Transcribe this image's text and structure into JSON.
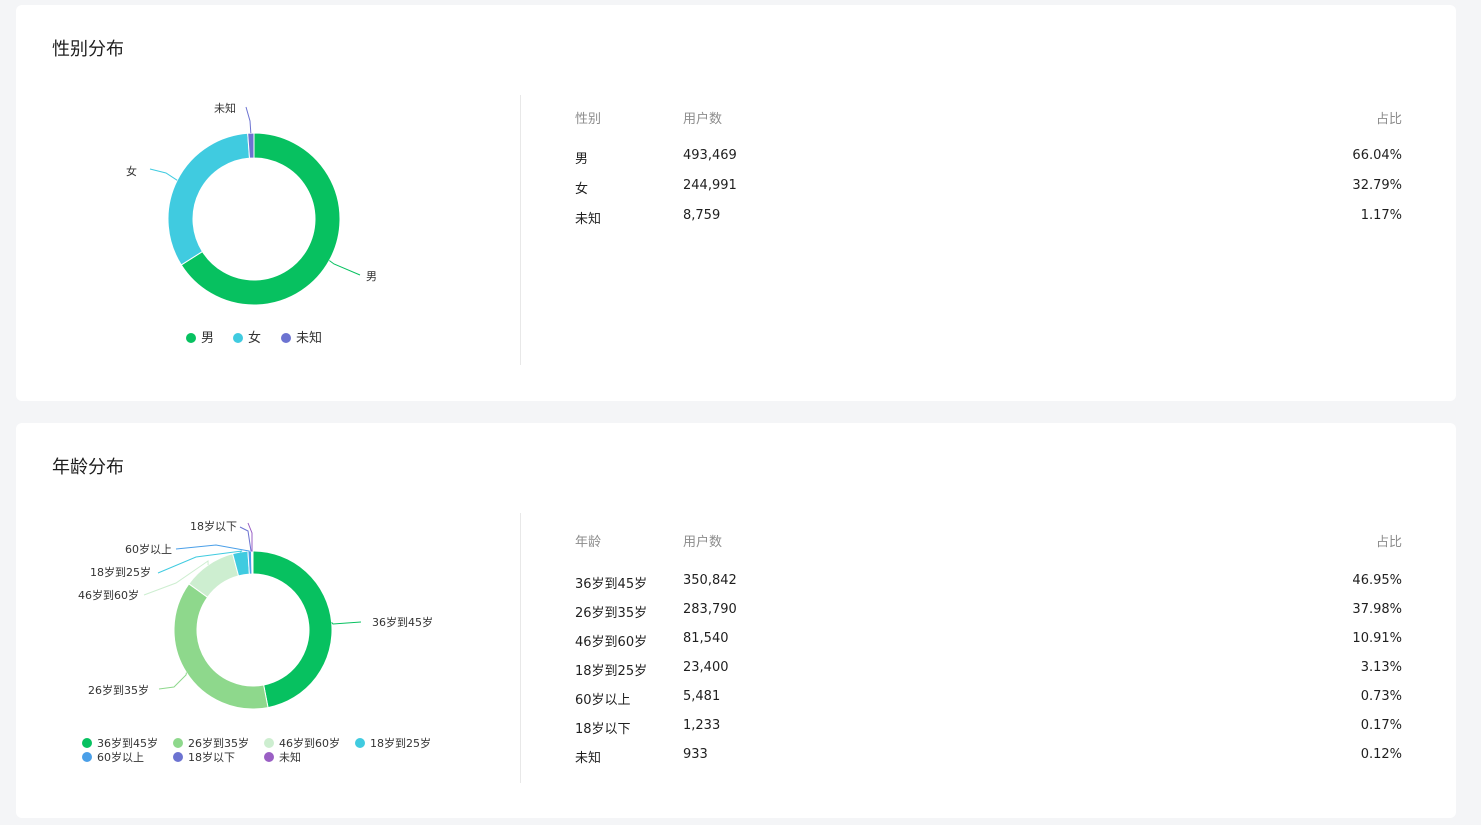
{
  "gender": {
    "title": "性别分布",
    "table": {
      "headers": [
        "性别",
        "用户数",
        "占比"
      ],
      "rows": [
        {
          "label": "男",
          "users": "493,469",
          "pct": "66.04%"
        },
        {
          "label": "女",
          "users": "244,991",
          "pct": "32.79%"
        },
        {
          "label": "未知",
          "users": "8,759",
          "pct": "1.17%"
        }
      ]
    }
  },
  "age": {
    "title": "年龄分布",
    "table": {
      "headers": [
        "年龄",
        "用户数",
        "占比"
      ],
      "rows": [
        {
          "label": "36岁到45岁",
          "users": "350,842",
          "pct": "46.95%"
        },
        {
          "label": "26岁到35岁",
          "users": "283,790",
          "pct": "37.98%"
        },
        {
          "label": "46岁到60岁",
          "users": "81,540",
          "pct": "10.91%"
        },
        {
          "label": "18岁到25岁",
          "users": "23,400",
          "pct": "3.13%"
        },
        {
          "label": "60岁以上",
          "users": "5,481",
          "pct": "0.73%"
        },
        {
          "label": "18岁以下",
          "users": "1,233",
          "pct": "0.17%"
        },
        {
          "label": "未知",
          "users": "933",
          "pct": "0.12%"
        }
      ]
    }
  },
  "chart_data": [
    {
      "type": "pie",
      "categories": [
        "男",
        "女",
        "未知"
      ],
      "values": [
        493469,
        244991,
        8759
      ],
      "colors": [
        "#07c160",
        "#40cbe0",
        "#6c73d1"
      ],
      "legend": "bottom"
    },
    {
      "type": "pie",
      "categories": [
        "36岁到45岁",
        "26岁到35岁",
        "46岁到60岁",
        "18岁到25岁",
        "60岁以上",
        "18岁以下",
        "未知"
      ],
      "values": [
        350842,
        283790,
        81540,
        23400,
        5481,
        1233,
        933
      ],
      "colors": [
        "#07c160",
        "#8ed88c",
        "#cdeed0",
        "#40cbe0",
        "#4a9fe8",
        "#6c73d1",
        "#9a5fc4"
      ],
      "legend": "bottom"
    }
  ]
}
